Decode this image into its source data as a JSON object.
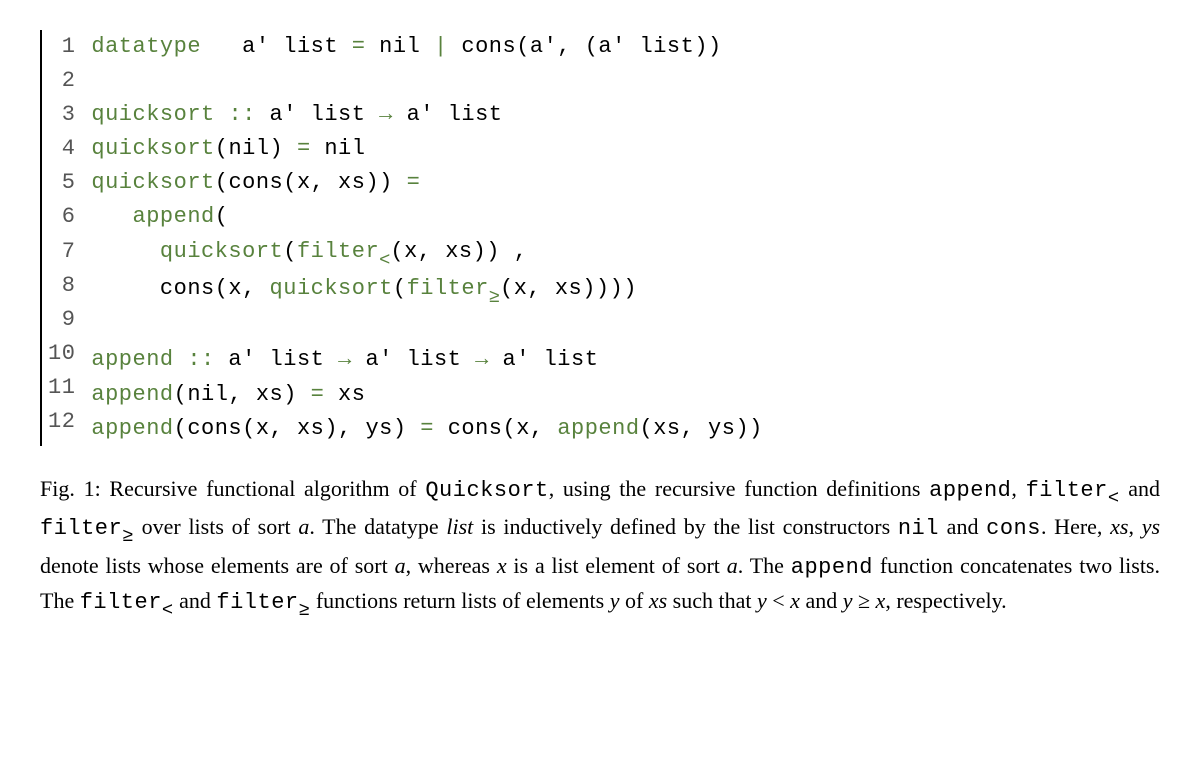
{
  "code": {
    "lines": [
      {
        "no": "1",
        "tokens": [
          [
            "kw",
            "datatype"
          ],
          [
            "plain",
            "   a' "
          ],
          [
            "plain",
            "list"
          ],
          [
            "plain",
            " "
          ],
          [
            "kw",
            "="
          ],
          [
            "plain",
            " "
          ],
          [
            "plain",
            "nil"
          ],
          [
            "plain",
            " "
          ],
          [
            "kw",
            "|"
          ],
          [
            "plain",
            " "
          ],
          [
            "plain",
            "cons"
          ],
          [
            "plain",
            "(a', (a' "
          ],
          [
            "plain",
            "list"
          ],
          [
            "plain",
            "))"
          ]
        ]
      },
      {
        "no": "2",
        "tokens": []
      },
      {
        "no": "3",
        "tokens": [
          [
            "kw",
            "quicksort"
          ],
          [
            "plain",
            " "
          ],
          [
            "sym",
            "::"
          ],
          [
            "plain",
            " a' "
          ],
          [
            "plain",
            "list"
          ],
          [
            "plain",
            " "
          ],
          [
            "sym",
            "→"
          ],
          [
            "plain",
            " a' "
          ],
          [
            "plain",
            "list"
          ]
        ]
      },
      {
        "no": "4",
        "tokens": [
          [
            "kw",
            "quicksort"
          ],
          [
            "plain",
            "("
          ],
          [
            "plain",
            "nil"
          ],
          [
            "plain",
            ") "
          ],
          [
            "kw",
            "="
          ],
          [
            "plain",
            " "
          ],
          [
            "plain",
            "nil"
          ]
        ]
      },
      {
        "no": "5",
        "tokens": [
          [
            "kw",
            "quicksort"
          ],
          [
            "plain",
            "("
          ],
          [
            "plain",
            "cons"
          ],
          [
            "plain",
            "(x, xs)) "
          ],
          [
            "kw",
            "="
          ]
        ]
      },
      {
        "no": "6",
        "tokens": [
          [
            "plain",
            "   "
          ],
          [
            "kw",
            "append"
          ],
          [
            "plain",
            "("
          ]
        ]
      },
      {
        "no": "7",
        "tokens": [
          [
            "plain",
            "     "
          ],
          [
            "kw",
            "quicksort"
          ],
          [
            "plain",
            "("
          ],
          [
            "kw",
            "filter"
          ],
          [
            "sub",
            "<"
          ],
          [
            "plain",
            "(x, xs)) ,"
          ]
        ]
      },
      {
        "no": "8",
        "tokens": [
          [
            "plain",
            "     "
          ],
          [
            "plain",
            "cons"
          ],
          [
            "plain",
            "(x, "
          ],
          [
            "kw",
            "quicksort"
          ],
          [
            "plain",
            "("
          ],
          [
            "kw",
            "filter"
          ],
          [
            "sub",
            "≥"
          ],
          [
            "plain",
            "(x, xs))))"
          ]
        ]
      },
      {
        "no": "9",
        "tokens": []
      },
      {
        "no": "10",
        "tokens": [
          [
            "kw",
            "append"
          ],
          [
            "plain",
            " "
          ],
          [
            "sym",
            "::"
          ],
          [
            "plain",
            " a' "
          ],
          [
            "plain",
            "list"
          ],
          [
            "plain",
            " "
          ],
          [
            "sym",
            "→"
          ],
          [
            "plain",
            " a' "
          ],
          [
            "plain",
            "list"
          ],
          [
            "plain",
            " "
          ],
          [
            "sym",
            "→"
          ],
          [
            "plain",
            " a' "
          ],
          [
            "plain",
            "list"
          ]
        ]
      },
      {
        "no": "11",
        "tokens": [
          [
            "kw",
            "append"
          ],
          [
            "plain",
            "("
          ],
          [
            "plain",
            "nil"
          ],
          [
            "plain",
            ", xs) "
          ],
          [
            "kw",
            "="
          ],
          [
            "plain",
            " xs"
          ]
        ]
      },
      {
        "no": "12",
        "tokens": [
          [
            "kw",
            "append"
          ],
          [
            "plain",
            "("
          ],
          [
            "plain",
            "cons"
          ],
          [
            "plain",
            "(x, xs), ys) "
          ],
          [
            "kw",
            "="
          ],
          [
            "plain",
            " "
          ],
          [
            "plain",
            "cons"
          ],
          [
            "plain",
            "(x, "
          ],
          [
            "kw",
            "append"
          ],
          [
            "plain",
            "(xs, ys))"
          ]
        ]
      }
    ]
  },
  "caption": {
    "label": "Fig. 1: ",
    "parts": [
      [
        "plain",
        "Recursive functional algorithm of "
      ],
      [
        "tt",
        "Quicksort"
      ],
      [
        "plain",
        ", using the recursive function definitions "
      ],
      [
        "tt",
        "append"
      ],
      [
        "plain",
        ", "
      ],
      [
        "tt",
        "filter"
      ],
      [
        "ttsub",
        "<"
      ],
      [
        "plain",
        " and "
      ],
      [
        "tt",
        "filter"
      ],
      [
        "ttsub",
        "≥"
      ],
      [
        "plain",
        " over lists of sort "
      ],
      [
        "it",
        "a"
      ],
      [
        "plain",
        ". The datatype "
      ],
      [
        "it",
        "list"
      ],
      [
        "plain",
        " is inductively defined by the list constructors "
      ],
      [
        "tt",
        "nil"
      ],
      [
        "plain",
        " and "
      ],
      [
        "tt",
        "cons"
      ],
      [
        "plain",
        ". Here, "
      ],
      [
        "it",
        "xs"
      ],
      [
        "plain",
        ", "
      ],
      [
        "it",
        "ys"
      ],
      [
        "plain",
        " denote lists whose elements are of sort "
      ],
      [
        "it",
        "a"
      ],
      [
        "plain",
        ", whereas "
      ],
      [
        "it",
        "x"
      ],
      [
        "plain",
        " is a list element of sort "
      ],
      [
        "it",
        "a"
      ],
      [
        "plain",
        ". The "
      ],
      [
        "tt",
        "append"
      ],
      [
        "plain",
        " function concatenates two lists. The "
      ],
      [
        "tt",
        "filter"
      ],
      [
        "ttsub",
        "<"
      ],
      [
        "plain",
        " and "
      ],
      [
        "tt",
        "filter"
      ],
      [
        "ttsub",
        "≥"
      ],
      [
        "plain",
        " functions return lists of elements "
      ],
      [
        "it",
        "y"
      ],
      [
        "plain",
        " of "
      ],
      [
        "it",
        "xs"
      ],
      [
        "plain",
        " such that "
      ],
      [
        "it",
        "y"
      ],
      [
        "plain",
        " < "
      ],
      [
        "it",
        "x"
      ],
      [
        "plain",
        " and "
      ],
      [
        "it",
        "y"
      ],
      [
        "plain",
        " ≥ "
      ],
      [
        "it",
        "x"
      ],
      [
        "plain",
        ", respectively."
      ]
    ]
  }
}
